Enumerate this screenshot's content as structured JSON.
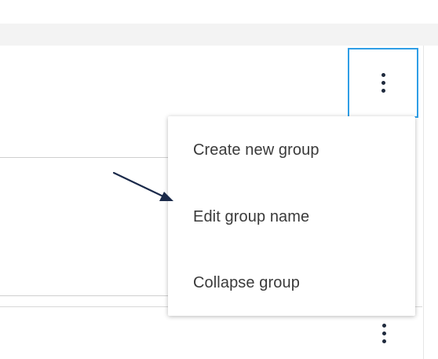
{
  "context_menu": {
    "items": [
      {
        "label": "Create new group"
      },
      {
        "label": "Edit group name"
      },
      {
        "label": "Collapse group"
      }
    ]
  },
  "icons": {
    "primary_button": "more-vertical-icon",
    "secondary_button": "more-vertical-icon",
    "annotation": "arrow-icon"
  },
  "colors": {
    "focus_border": "#2f9ee6",
    "icon": "#1f2a3d",
    "menu_text": "#3a3a3a",
    "arrow": "#1b2a4a",
    "band": "#f3f3f3"
  }
}
